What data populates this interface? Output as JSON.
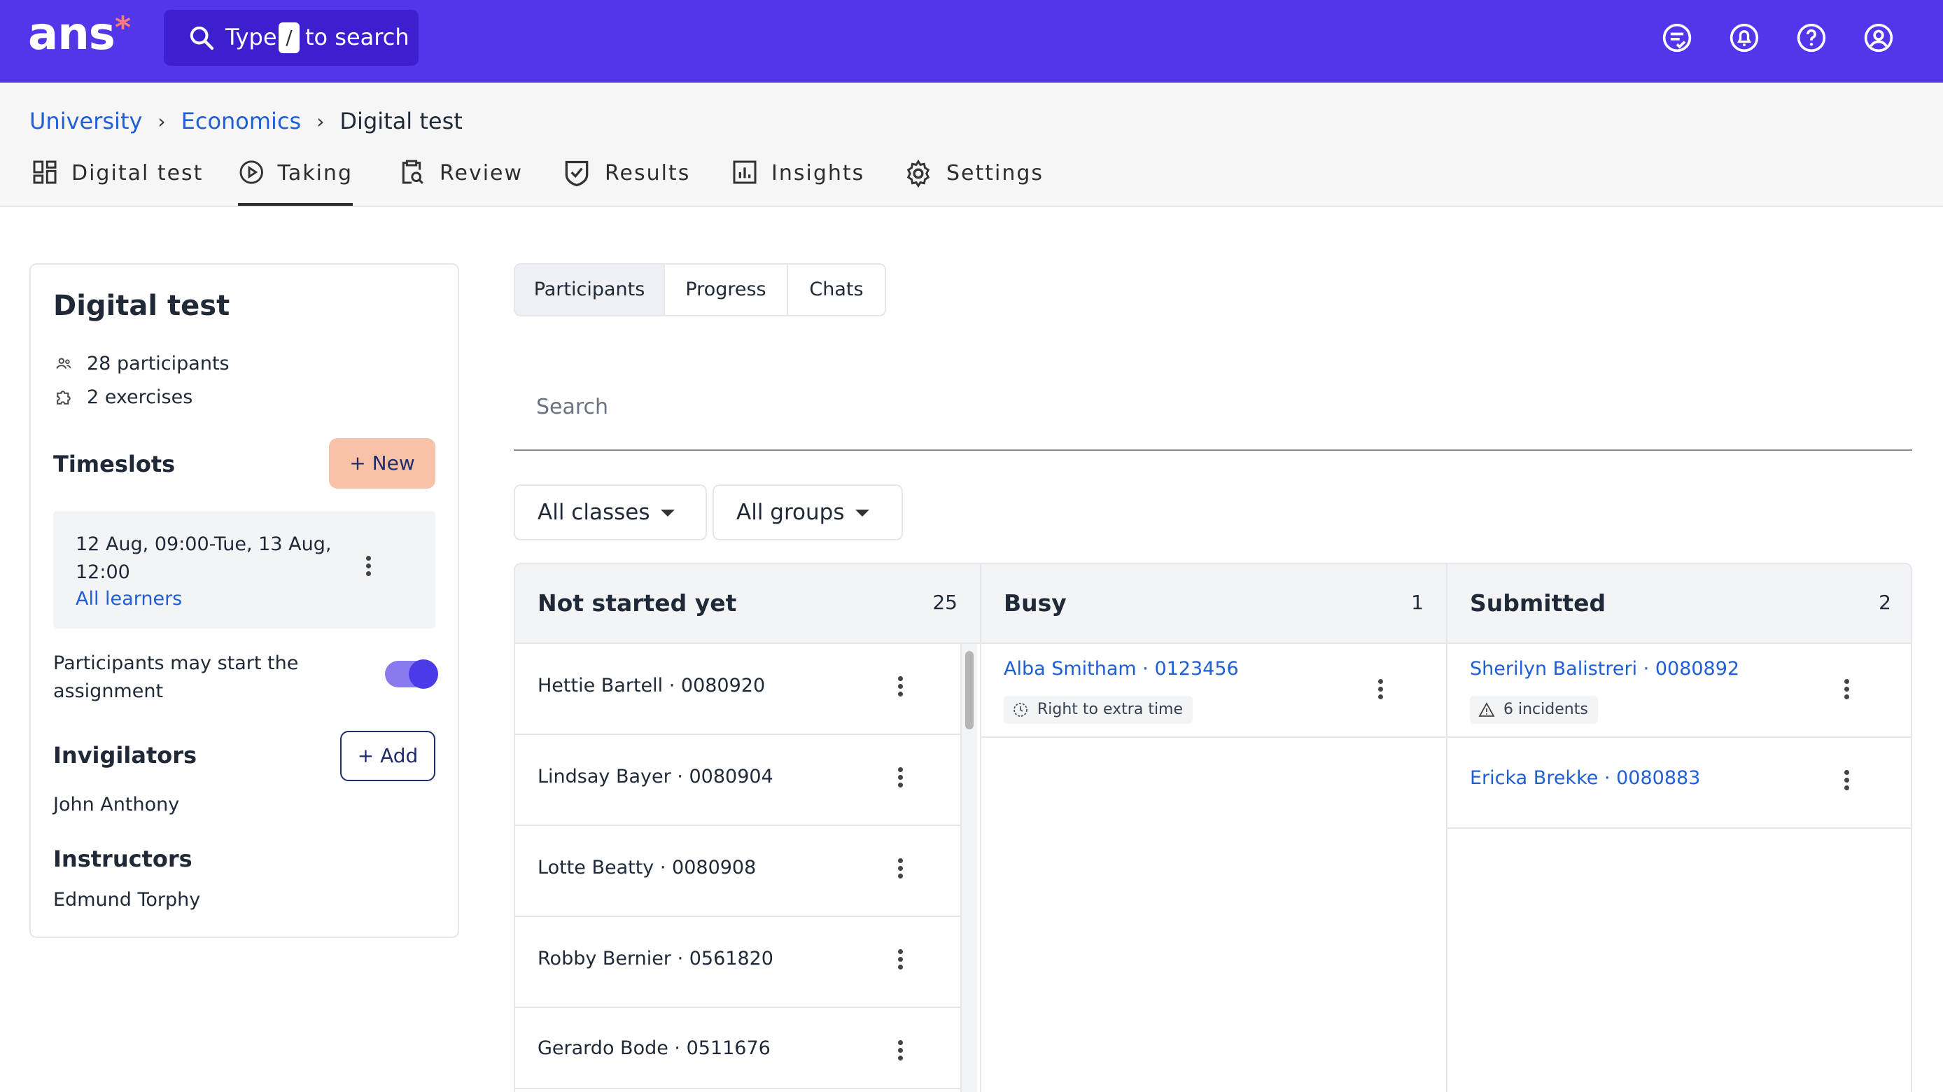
{
  "app": {
    "logo": "ans",
    "logo_mark": "*"
  },
  "search": {
    "prefix": "Type",
    "key": "/",
    "suffix": "to search"
  },
  "header_icons": [
    "feedback-icon",
    "notifications-icon",
    "help-icon",
    "account-icon"
  ],
  "breadcrumb": [
    {
      "label": "University",
      "link": true
    },
    {
      "label": "Economics",
      "link": true
    },
    {
      "label": "Digital test",
      "link": false
    }
  ],
  "tabs": [
    {
      "label": "Digital test",
      "icon": "dashboard-icon",
      "active": false
    },
    {
      "label": "Taking",
      "icon": "play-circle-icon",
      "active": true
    },
    {
      "label": "Review",
      "icon": "clipboard-search-icon",
      "active": false
    },
    {
      "label": "Results",
      "icon": "shield-check-icon",
      "active": false
    },
    {
      "label": "Insights",
      "icon": "bar-chart-icon",
      "active": false
    },
    {
      "label": "Settings",
      "icon": "gear-icon",
      "active": false
    }
  ],
  "sidebar": {
    "title": "Digital test",
    "participants": "28 participants",
    "exercises": "2 exercises",
    "timeslots_title": "Timeslots",
    "new_label": "+ New",
    "timeslot": {
      "time": "12 Aug, 09:00-Tue, 13 Aug, 12:00",
      "learners": "All learners"
    },
    "toggle_label": "Participants may start the assignment",
    "toggle_on": true,
    "invigilators_title": "Invigilators",
    "add_label": "+ Add",
    "invigilator": "John Anthony",
    "instructors_title": "Instructors",
    "instructor": "Edmund Torphy"
  },
  "subtabs": [
    {
      "label": "Participants",
      "active": true
    },
    {
      "label": "Progress",
      "active": false
    },
    {
      "label": "Chats",
      "active": false
    }
  ],
  "search_field": {
    "placeholder": "Search"
  },
  "filters": {
    "classes": "All classes",
    "groups": "All groups"
  },
  "board": {
    "not_started": {
      "title": "Not started yet",
      "count": "25",
      "items": [
        "Hettie Bartell · 0080920",
        "Lindsay Bayer · 0080904",
        "Lotte Beatty · 0080908",
        "Robby Bernier · 0561820",
        "Gerardo Bode · 0511676"
      ]
    },
    "busy": {
      "title": "Busy",
      "count": "1",
      "items": [
        {
          "name": "Alba Smitham · 0123456",
          "badge": "Right to extra time"
        }
      ]
    },
    "submitted": {
      "title": "Submitted",
      "count": "2",
      "items": [
        {
          "name": "Sherilyn Balistreri · 0080892",
          "badge": "6 incidents"
        },
        {
          "name": "Ericka Brekke · 0080883",
          "badge": ""
        }
      ]
    }
  },
  "colors": {
    "topbar": "#5335ea",
    "link": "#1f5fd6",
    "new_button": "#f7c2a8",
    "toggle": "#4a3ae8"
  }
}
